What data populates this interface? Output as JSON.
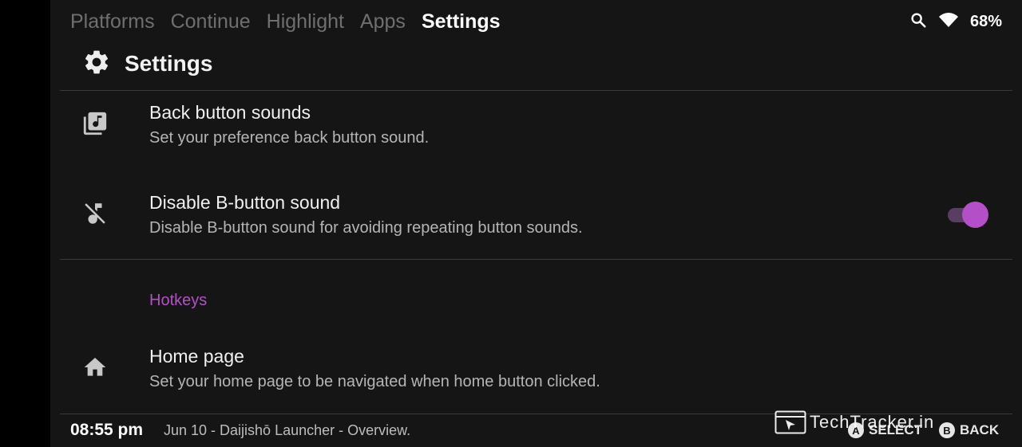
{
  "nav": {
    "tabs": [
      {
        "label": "Platforms"
      },
      {
        "label": "Continue"
      },
      {
        "label": "Highlight"
      },
      {
        "label": "Apps"
      },
      {
        "label": "Settings"
      }
    ]
  },
  "status": {
    "battery": "68%",
    "icons": [
      "search-icon",
      "wifi-icon"
    ]
  },
  "page": {
    "title": "Settings",
    "title_icon": "gear-icon"
  },
  "settings": {
    "back_sounds": {
      "title": "Back button sounds",
      "description": "Set your preference back button sound.",
      "icon": "music-library-icon"
    },
    "disable_b_sound": {
      "title": "Disable B-button sound",
      "description": "Disable B-button sound for avoiding repeating button sounds.",
      "icon": "music-off-icon",
      "enabled": true
    },
    "section_hotkeys": "Hotkeys",
    "home_page": {
      "title": "Home page",
      "description": "Set your home page to be navigated when home button clicked.",
      "icon": "home-icon"
    }
  },
  "bottom": {
    "time": "08:55 pm",
    "info": "Jun 10 - Daijishō Launcher - Overview.",
    "hint_select_key": "A",
    "hint_select": "SELECT",
    "hint_back_key": "B",
    "hint_back": "BACK"
  },
  "watermark": {
    "text": "TechTracker.in"
  },
  "colors": {
    "background": "#151515",
    "accent": "#b44fc8",
    "toggle_track": "#5a3d63"
  }
}
